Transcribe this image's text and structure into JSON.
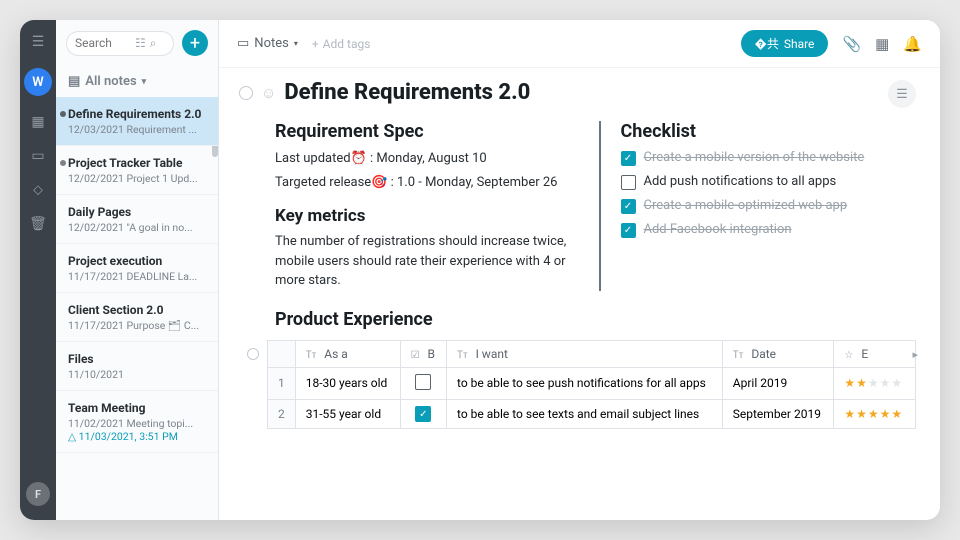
{
  "rail": {
    "avatar": "W",
    "bottom": "F"
  },
  "search": {
    "placeholder": "Search"
  },
  "addbtn": "+",
  "allnotes": {
    "label": "All notes"
  },
  "notes": [
    {
      "title": "Define Requirements 2.0",
      "date": "12/03/2021",
      "preview": "Requirement ...",
      "selected": true,
      "dot": true
    },
    {
      "title": "Project Tracker Table",
      "date": "12/02/2021",
      "preview": "Project 1 Upd...",
      "dot": true
    },
    {
      "title": "Daily Pages",
      "date": "12/02/2021",
      "preview": "\"A goal in no..."
    },
    {
      "title": "Project execution",
      "date": "11/17/2021",
      "preview": "DEADLINE La..."
    },
    {
      "title": "Client Section 2.0",
      "date": "11/17/2021",
      "preview": "Purpose 🗂 C..."
    },
    {
      "title": "Files",
      "date": "11/10/2021",
      "preview": ""
    },
    {
      "title": "Team Meeting",
      "date": "11/02/2021",
      "preview": "Meeting topi...",
      "alert": "11/03/2021, 3:51 PM"
    }
  ],
  "crumb": "Notes",
  "addtags": "Add tags",
  "share": "Share",
  "title": "Define Requirements 2.0",
  "spec": {
    "heading": "Requirement Spec",
    "l1": "Last updated⏰ : Monday, August 10",
    "l2": "Targeted release🎯 : 1.0 - Monday, September 26"
  },
  "metrics": {
    "heading": "Key metrics",
    "body": "The number of registrations should increase twice, mobile users should rate their experience with 4 or more stars."
  },
  "checklist": {
    "heading": "Checklist",
    "items": [
      {
        "text": "Create a mobile version of the website",
        "done": true
      },
      {
        "text": "Add push notifications to all apps",
        "done": false
      },
      {
        "text": "Create a mobile-optimized web app",
        "done": true
      },
      {
        "text": "Add Facebook integration",
        "done": true
      }
    ]
  },
  "experience": {
    "heading": "Product Experience"
  },
  "table": {
    "cols": [
      "As a",
      "B",
      "I want",
      "Date",
      "E"
    ],
    "rows": [
      {
        "n": "1",
        "asa": "18-30 years old",
        "b": false,
        "want": "to be able to see push notifications for all apps",
        "date": "April 2019",
        "stars": 2
      },
      {
        "n": "2",
        "asa": "31-55 year old",
        "b": true,
        "want": "to be able to see texts and email subject lines",
        "date": "September 2019",
        "stars": 5
      }
    ]
  }
}
